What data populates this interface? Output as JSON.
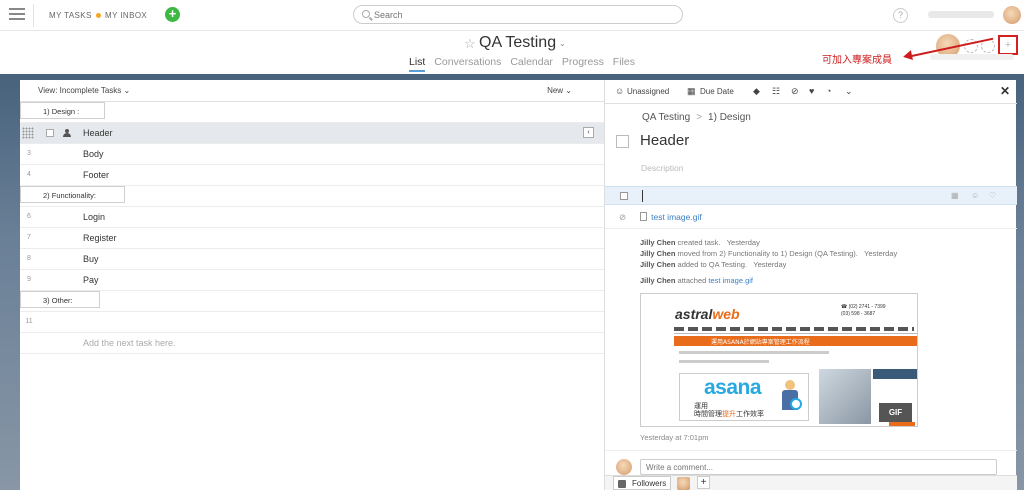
{
  "topbar": {
    "my_tasks": "MY TASKS",
    "my_inbox": "MY INBOX",
    "search_placeholder": "Search",
    "help": "?",
    "add": "+"
  },
  "project": {
    "star": "☆",
    "title": "QA Testing",
    "caret": "⌄",
    "tabs": [
      {
        "label": "List",
        "active": true
      },
      {
        "label": "Conversations",
        "active": false
      },
      {
        "label": "Calendar",
        "active": false
      },
      {
        "label": "Progress",
        "active": false
      },
      {
        "label": "Files",
        "active": false
      }
    ],
    "add_member": "+"
  },
  "annotation": {
    "text": "可加入專案成員",
    "color": "#cc1e1e"
  },
  "list": {
    "view_label": "View: Incomplete Tasks ⌄",
    "new_label": "New ⌄",
    "rows": [
      {
        "kind": "section",
        "num": "",
        "label": "1) Design :"
      },
      {
        "kind": "task-selected",
        "num": "",
        "label": "Header"
      },
      {
        "kind": "task",
        "num": "3",
        "label": "Body"
      },
      {
        "kind": "task",
        "num": "4",
        "label": "Footer"
      },
      {
        "kind": "section",
        "num": "",
        "label": "2) Functionality:"
      },
      {
        "kind": "task",
        "num": "6",
        "label": "Login"
      },
      {
        "kind": "task",
        "num": "7",
        "label": "Register"
      },
      {
        "kind": "task",
        "num": "8",
        "label": "Buy"
      },
      {
        "kind": "task",
        "num": "9",
        "label": "Pay"
      },
      {
        "kind": "section",
        "num": "",
        "label": "3) Other:"
      },
      {
        "kind": "task",
        "num": "11",
        "label": ""
      },
      {
        "kind": "add",
        "num": "",
        "label": "Add the next task here."
      }
    ]
  },
  "detail": {
    "toolbar": {
      "unassigned": "Unassigned",
      "due_date": "Due Date",
      "close": "✕"
    },
    "breadcrumb_project": "QA Testing",
    "breadcrumb_sep": ">",
    "breadcrumb_section": "1) Design",
    "task_title": "Header",
    "description_placeholder": "Description",
    "attachment_name": "test image.gif",
    "stories": [
      {
        "who": "Jilly Chen",
        "text": " created task.",
        "when": "Yesterday"
      },
      {
        "who": "Jilly Chen",
        "text": " moved from 2) Functionality to 1) Design  (QA Testing).",
        "when": "Yesterday"
      },
      {
        "who": "Jilly Chen",
        "text": " added to QA Testing.",
        "when": "Yesterday"
      }
    ],
    "attached_who": "Jilly Chen",
    "attached_text": " attached ",
    "attached_file": "test image.gif",
    "preview": {
      "logo_a": "astral",
      "logo_b": "web",
      "phone1": "☎ (02) 2741 - 7399",
      "phone2": "(03) 598 - 3687",
      "banner": "運用ASANA於網站專案管理工作流程",
      "asana_word": "asana",
      "asana_sub1": "運用",
      "asana_sub2a": "時間管理",
      "asana_sub2b": "提升",
      "asana_sub2c": "工作效率",
      "gif_badge": "GIF"
    },
    "timestamp": "Yesterday at 7:01pm",
    "comment_placeholder": "Write a comment...",
    "followers_label": "Followers",
    "follower_add": "+"
  }
}
